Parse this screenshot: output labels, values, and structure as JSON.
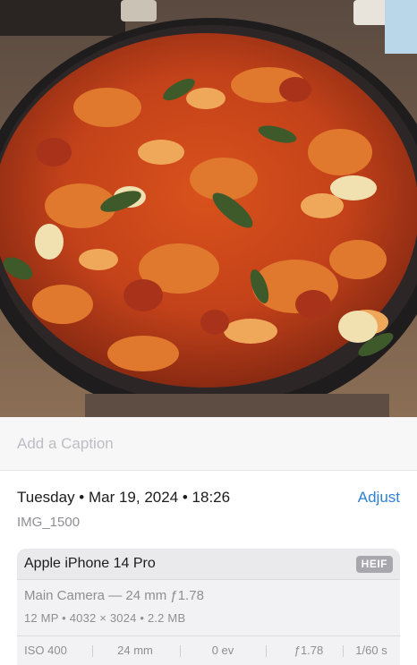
{
  "caption": {
    "placeholder": "Add a Caption",
    "value": ""
  },
  "info": {
    "date": "Tuesday • Mar 19, 2024 • 18:26",
    "adjust_label": "Adjust",
    "filename": "IMG_1500"
  },
  "camera": {
    "device": "Apple iPhone 14 Pro",
    "format": "HEIF",
    "lens": "Main Camera — 24 mm ƒ1.78",
    "specs": "12 MP  •  4032 × 3024  •  2.2 MB",
    "exif": {
      "iso": "ISO 400",
      "focal_length": "24 mm",
      "exposure": "0 ev",
      "aperture": "ƒ1.78",
      "shutter": "1/60 s"
    }
  },
  "colors": {
    "accent": "#2f80d6",
    "secondary_text": "#8e8e93"
  }
}
